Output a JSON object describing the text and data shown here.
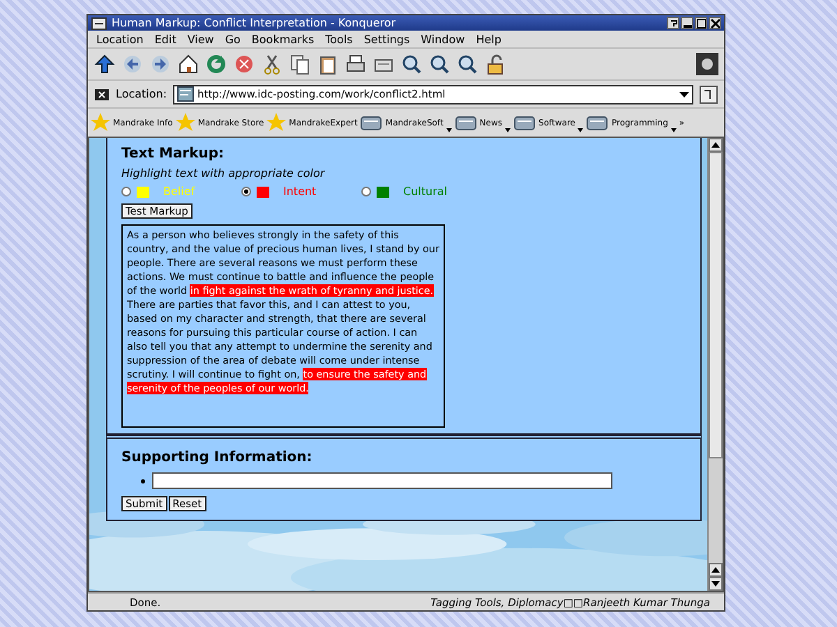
{
  "window": {
    "title": "Human Markup: Conflict Interpretation - Konqueror"
  },
  "menu": [
    "Location",
    "Edit",
    "View",
    "Go",
    "Bookmarks",
    "Tools",
    "Settings",
    "Window",
    "Help"
  ],
  "location": {
    "label": "Location:",
    "url": "http://www.idc-posting.com/work/conflict2.html"
  },
  "bookmarks": [
    {
      "label": "Mandrake Info",
      "kind": "star"
    },
    {
      "label": "Mandrake Store",
      "kind": "star"
    },
    {
      "label": "MandrakeExpert",
      "kind": "star"
    },
    {
      "label": "MandrakeSoft",
      "kind": "folder"
    },
    {
      "label": "News",
      "kind": "folder"
    },
    {
      "label": "Software",
      "kind": "folder"
    },
    {
      "label": "Programming",
      "kind": "folder"
    },
    {
      "label": "»",
      "kind": "more"
    }
  ],
  "markup": {
    "heading": "Text Markup:",
    "instruction": "Highlight text with appropriate color",
    "options": [
      {
        "label": "Belief",
        "color": "#ffff00",
        "selected": false
      },
      {
        "label": "Intent",
        "color": "#ff0000",
        "selected": true
      },
      {
        "label": "Cultural",
        "color": "#008000",
        "selected": false
      }
    ],
    "button": "Test Markup",
    "passage": [
      {
        "text": "As a person who believes strongly in the safety of this country, and the value of precious human lives, I stand by our people. There are several reasons we must perform these actions. We must continue to battle and influence the people of the world ",
        "highlighted": false
      },
      {
        "text": "in fight against the wrath of tyranny and justice.",
        "highlighted": true
      },
      {
        "text": " There are parties that favor this, and I can attest to you, based on my character and strength, that there are several reasons for pursuing this particular course of action. I can also tell you that any attempt to undermine the serenity and suppression of the area of debate will come under intense scrutiny. I will continue to fight on, ",
        "highlighted": false
      },
      {
        "text": "to ensure the safety and serenity of the peoples of our world.",
        "highlighted": true
      }
    ]
  },
  "supporting": {
    "heading": "Supporting Information:",
    "buttons": [
      "Submit",
      "Reset"
    ]
  },
  "status_bar": {
    "left": "Done.",
    "right": "Tagging Tools, Diplomacy□□Ranjeeth Kumar Thunga"
  }
}
